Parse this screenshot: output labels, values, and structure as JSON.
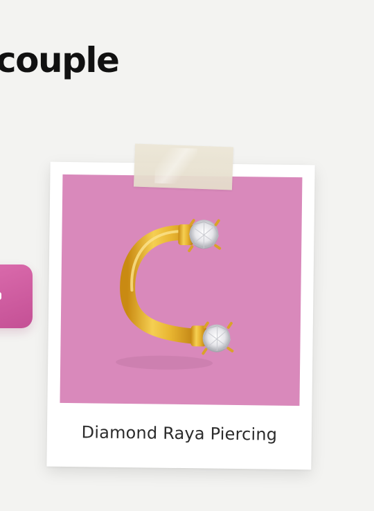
{
  "headline": {
    "text": "couple"
  },
  "plus_tile": {
    "icon": "plus-icon",
    "color": "#d063a5"
  },
  "product_card": {
    "caption": "Diamond Raya Piercing",
    "photo_background": "#d989bb",
    "image_alt": "gold horseshoe piercing with two diamonds",
    "metal_color": "#e8b531"
  }
}
